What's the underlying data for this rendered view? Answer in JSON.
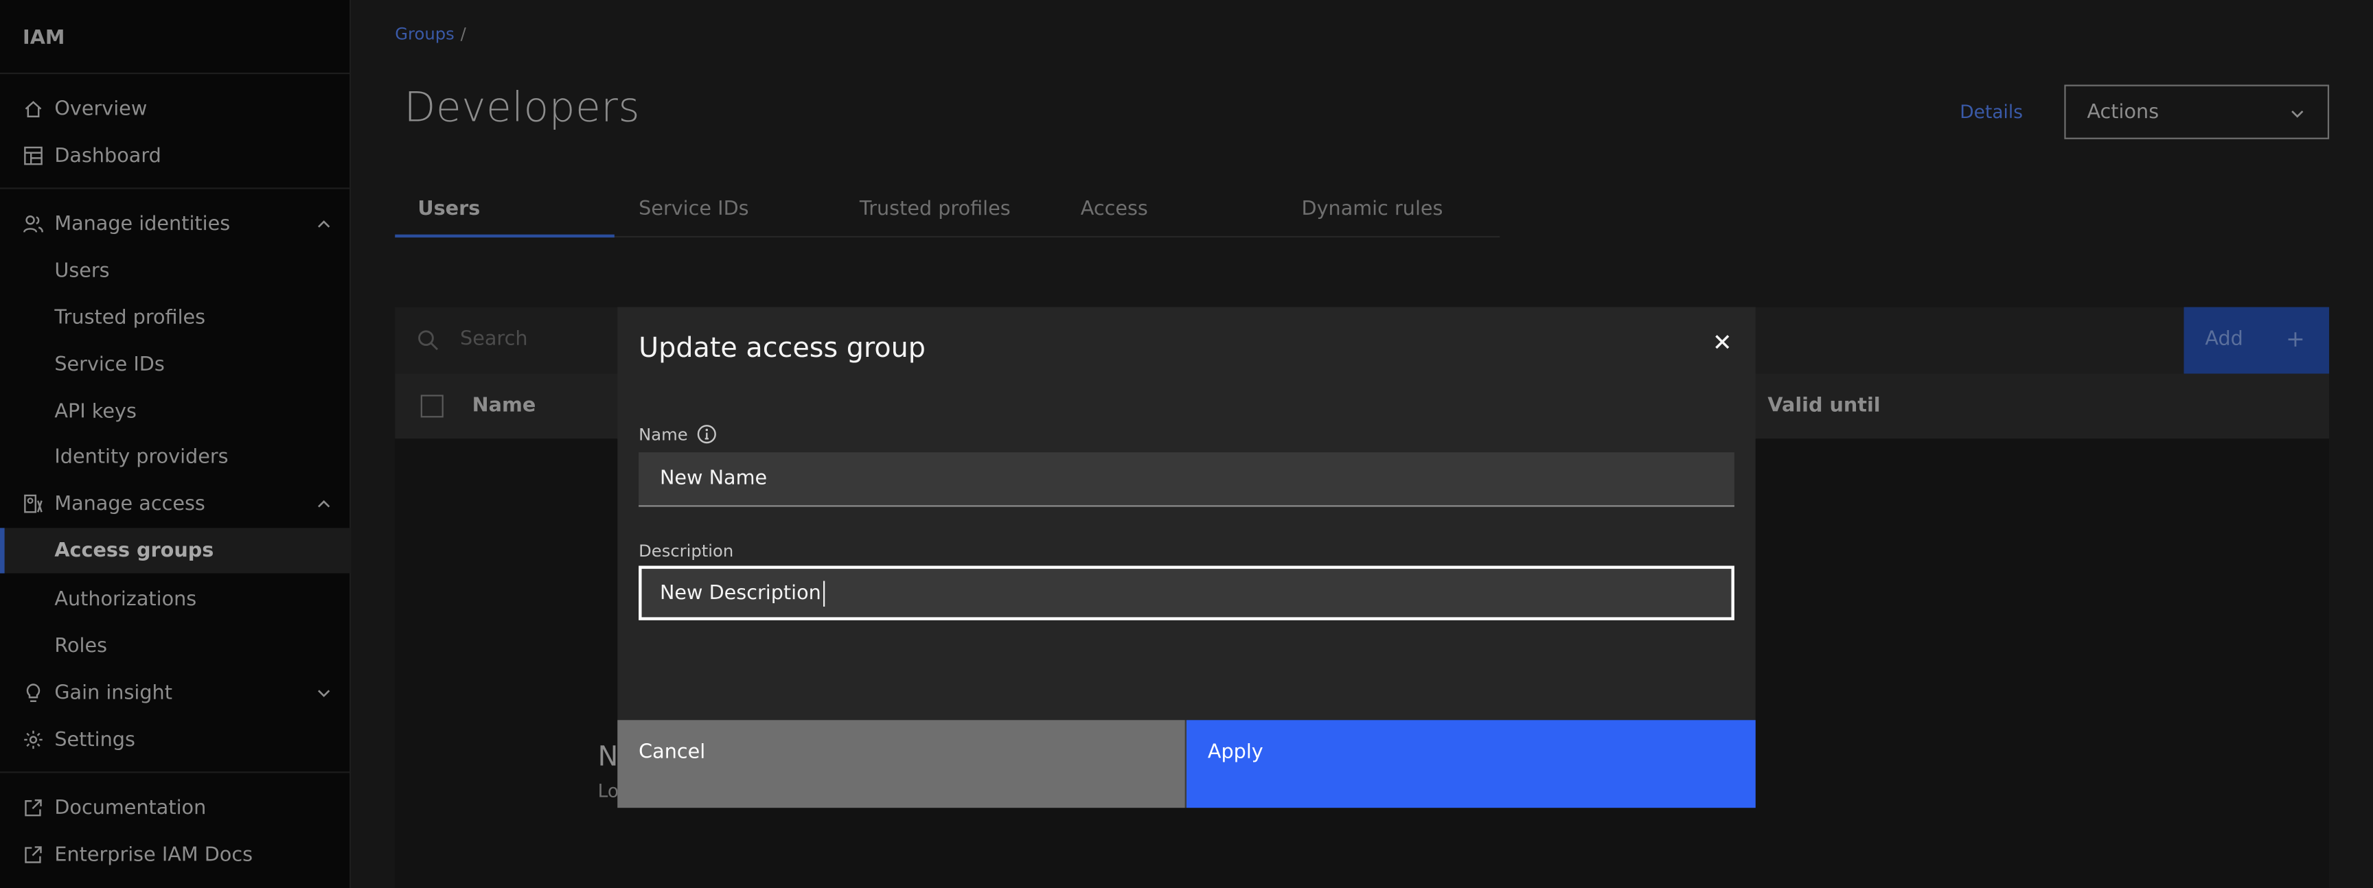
{
  "sidebar": {
    "title": "IAM",
    "items": [
      {
        "label": "Overview",
        "icon": "home-icon"
      },
      {
        "label": "Dashboard",
        "icon": "dashboard-icon"
      },
      {
        "label": "Manage identities",
        "icon": "users-icon"
      },
      {
        "label": "Users"
      },
      {
        "label": "Trusted profiles"
      },
      {
        "label": "Service IDs"
      },
      {
        "label": "API keys"
      },
      {
        "label": "Identity providers"
      },
      {
        "label": "Manage access",
        "icon": "access-icon"
      },
      {
        "label": "Access groups",
        "active": true
      },
      {
        "label": "Authorizations"
      },
      {
        "label": "Roles"
      },
      {
        "label": "Gain insight",
        "icon": "lightbulb-icon"
      },
      {
        "label": "Settings",
        "icon": "gear-icon"
      },
      {
        "label": "Documentation",
        "icon": "external-link-icon"
      },
      {
        "label": "Enterprise IAM Docs",
        "icon": "external-link-icon"
      }
    ]
  },
  "breadcrumb": {
    "item": "Groups",
    "separator": "/"
  },
  "page": {
    "title": "Developers",
    "details_link": "Details",
    "actions_label": "Actions"
  },
  "tabs": [
    "Users",
    "Service IDs",
    "Trusted profiles",
    "Access",
    "Dynamic rules"
  ],
  "toolbar": {
    "search_placeholder": "Search",
    "add_label": "Add",
    "add_icon": "+"
  },
  "table": {
    "columns": [
      "Name",
      "Valid until"
    ],
    "empty_title": "N",
    "empty_subtitle": "Lo"
  },
  "modal": {
    "title": "Update access group",
    "name_label": "Name",
    "name_value": "New Name",
    "description_label": "Description",
    "description_value": "New Description",
    "cancel_label": "Cancel",
    "apply_label": "Apply"
  },
  "colors": {
    "background": "#161616",
    "sidebar": "#080808",
    "modal": "#262626",
    "apply": "#2f62f5",
    "cancel": "#6f6f6f",
    "link": "#3a5aa8"
  }
}
